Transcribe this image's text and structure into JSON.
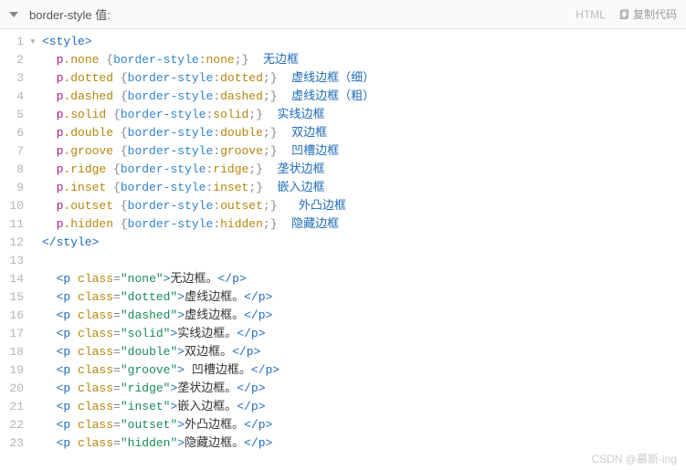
{
  "header": {
    "title": "border-style 值:",
    "lang": "HTML",
    "copy": "复制代码"
  },
  "lines": [
    {
      "n": 1,
      "fold": "▾",
      "type": "tag",
      "tag": "style",
      "open": true
    },
    {
      "n": 2,
      "type": "rule",
      "sel": "p",
      "cls": "none",
      "prop": "border-style",
      "val": "none",
      "comment": "无边框"
    },
    {
      "n": 3,
      "type": "rule",
      "sel": "p",
      "cls": "dotted",
      "prop": "border-style",
      "val": "dotted",
      "comment": "虚线边框（细）"
    },
    {
      "n": 4,
      "type": "rule",
      "sel": "p",
      "cls": "dashed",
      "prop": "border-style",
      "val": "dashed",
      "comment": "虚线边框（粗）"
    },
    {
      "n": 5,
      "type": "rule",
      "sel": "p",
      "cls": "solid",
      "prop": "border-style",
      "val": "solid",
      "comment": "实线边框"
    },
    {
      "n": 6,
      "type": "rule",
      "sel": "p",
      "cls": "double",
      "prop": "border-style",
      "val": "double",
      "comment": "双边框"
    },
    {
      "n": 7,
      "type": "rule",
      "sel": "p",
      "cls": "groove",
      "prop": "border-style",
      "val": "groove",
      "comment": "凹槽边框"
    },
    {
      "n": 8,
      "type": "rule",
      "sel": "p",
      "cls": "ridge",
      "prop": "border-style",
      "val": "ridge",
      "comment": "垄状边框"
    },
    {
      "n": 9,
      "type": "rule",
      "sel": "p",
      "cls": "inset",
      "prop": "border-style",
      "val": "inset",
      "comment": "嵌入边框"
    },
    {
      "n": 10,
      "type": "rule",
      "sel": "p",
      "cls": "outset",
      "prop": "border-style",
      "val": "outset",
      "comment": " 外凸边框"
    },
    {
      "n": 11,
      "type": "rule",
      "sel": "p",
      "cls": "hidden",
      "prop": "border-style",
      "val": "hidden",
      "comment": "隐藏边框"
    },
    {
      "n": 12,
      "type": "tag",
      "tag": "style",
      "open": false
    },
    {
      "n": 13,
      "type": "blank"
    },
    {
      "n": 14,
      "type": "p",
      "cls": "none",
      "txt": "无边框。"
    },
    {
      "n": 15,
      "type": "p",
      "cls": "dotted",
      "txt": "虚线边框。"
    },
    {
      "n": 16,
      "type": "p",
      "cls": "dashed",
      "txt": "虚线边框。"
    },
    {
      "n": 17,
      "type": "p",
      "cls": "solid",
      "txt": "实线边框。"
    },
    {
      "n": 18,
      "type": "p",
      "cls": "double",
      "txt": "双边框。"
    },
    {
      "n": 19,
      "type": "p",
      "cls": "groove",
      "txt": " 凹槽边框。"
    },
    {
      "n": 20,
      "type": "p",
      "cls": "ridge",
      "txt": "垄状边框。"
    },
    {
      "n": 21,
      "type": "p",
      "cls": "inset",
      "txt": "嵌入边框。"
    },
    {
      "n": 22,
      "type": "p",
      "cls": "outset",
      "txt": "外凸边框。"
    },
    {
      "n": 23,
      "type": "p",
      "cls": "hidden",
      "txt": "隐藏边框。"
    }
  ],
  "watermark": "CSDN @慕斯-ing"
}
